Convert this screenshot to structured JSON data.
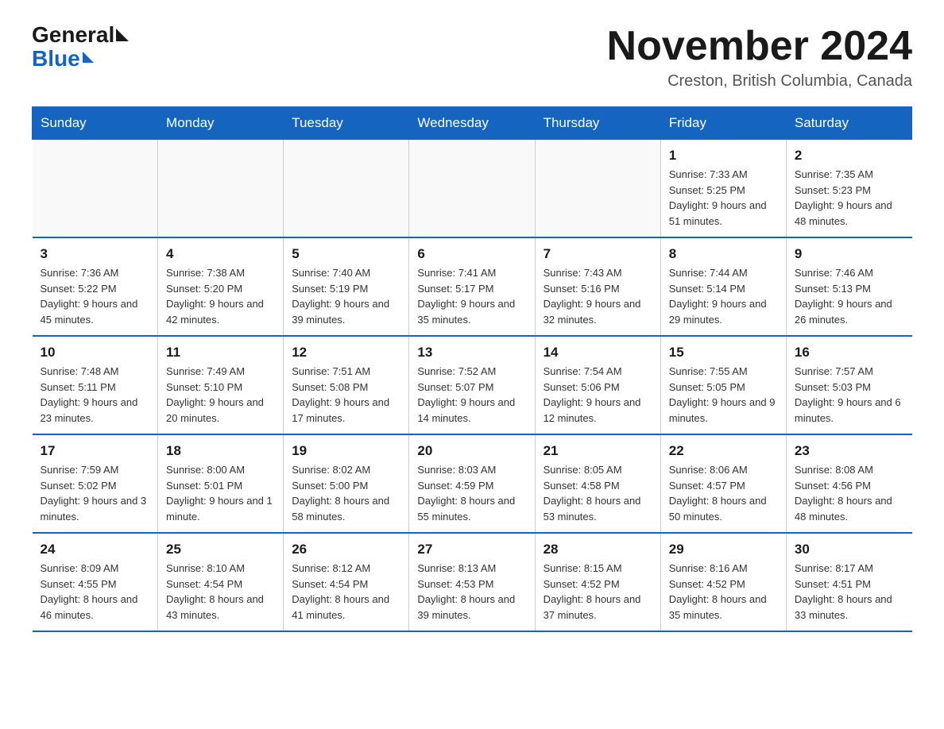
{
  "header": {
    "logo_general": "General",
    "logo_blue": "Blue",
    "month_title": "November 2024",
    "location": "Creston, British Columbia, Canada"
  },
  "days_of_week": [
    "Sunday",
    "Monday",
    "Tuesday",
    "Wednesday",
    "Thursday",
    "Friday",
    "Saturday"
  ],
  "weeks": [
    [
      {
        "day": "",
        "info": ""
      },
      {
        "day": "",
        "info": ""
      },
      {
        "day": "",
        "info": ""
      },
      {
        "day": "",
        "info": ""
      },
      {
        "day": "",
        "info": ""
      },
      {
        "day": "1",
        "info": "Sunrise: 7:33 AM\nSunset: 5:25 PM\nDaylight: 9 hours and 51 minutes."
      },
      {
        "day": "2",
        "info": "Sunrise: 7:35 AM\nSunset: 5:23 PM\nDaylight: 9 hours and 48 minutes."
      }
    ],
    [
      {
        "day": "3",
        "info": "Sunrise: 7:36 AM\nSunset: 5:22 PM\nDaylight: 9 hours and 45 minutes."
      },
      {
        "day": "4",
        "info": "Sunrise: 7:38 AM\nSunset: 5:20 PM\nDaylight: 9 hours and 42 minutes."
      },
      {
        "day": "5",
        "info": "Sunrise: 7:40 AM\nSunset: 5:19 PM\nDaylight: 9 hours and 39 minutes."
      },
      {
        "day": "6",
        "info": "Sunrise: 7:41 AM\nSunset: 5:17 PM\nDaylight: 9 hours and 35 minutes."
      },
      {
        "day": "7",
        "info": "Sunrise: 7:43 AM\nSunset: 5:16 PM\nDaylight: 9 hours and 32 minutes."
      },
      {
        "day": "8",
        "info": "Sunrise: 7:44 AM\nSunset: 5:14 PM\nDaylight: 9 hours and 29 minutes."
      },
      {
        "day": "9",
        "info": "Sunrise: 7:46 AM\nSunset: 5:13 PM\nDaylight: 9 hours and 26 minutes."
      }
    ],
    [
      {
        "day": "10",
        "info": "Sunrise: 7:48 AM\nSunset: 5:11 PM\nDaylight: 9 hours and 23 minutes."
      },
      {
        "day": "11",
        "info": "Sunrise: 7:49 AM\nSunset: 5:10 PM\nDaylight: 9 hours and 20 minutes."
      },
      {
        "day": "12",
        "info": "Sunrise: 7:51 AM\nSunset: 5:08 PM\nDaylight: 9 hours and 17 minutes."
      },
      {
        "day": "13",
        "info": "Sunrise: 7:52 AM\nSunset: 5:07 PM\nDaylight: 9 hours and 14 minutes."
      },
      {
        "day": "14",
        "info": "Sunrise: 7:54 AM\nSunset: 5:06 PM\nDaylight: 9 hours and 12 minutes."
      },
      {
        "day": "15",
        "info": "Sunrise: 7:55 AM\nSunset: 5:05 PM\nDaylight: 9 hours and 9 minutes."
      },
      {
        "day": "16",
        "info": "Sunrise: 7:57 AM\nSunset: 5:03 PM\nDaylight: 9 hours and 6 minutes."
      }
    ],
    [
      {
        "day": "17",
        "info": "Sunrise: 7:59 AM\nSunset: 5:02 PM\nDaylight: 9 hours and 3 minutes."
      },
      {
        "day": "18",
        "info": "Sunrise: 8:00 AM\nSunset: 5:01 PM\nDaylight: 9 hours and 1 minute."
      },
      {
        "day": "19",
        "info": "Sunrise: 8:02 AM\nSunset: 5:00 PM\nDaylight: 8 hours and 58 minutes."
      },
      {
        "day": "20",
        "info": "Sunrise: 8:03 AM\nSunset: 4:59 PM\nDaylight: 8 hours and 55 minutes."
      },
      {
        "day": "21",
        "info": "Sunrise: 8:05 AM\nSunset: 4:58 PM\nDaylight: 8 hours and 53 minutes."
      },
      {
        "day": "22",
        "info": "Sunrise: 8:06 AM\nSunset: 4:57 PM\nDaylight: 8 hours and 50 minutes."
      },
      {
        "day": "23",
        "info": "Sunrise: 8:08 AM\nSunset: 4:56 PM\nDaylight: 8 hours and 48 minutes."
      }
    ],
    [
      {
        "day": "24",
        "info": "Sunrise: 8:09 AM\nSunset: 4:55 PM\nDaylight: 8 hours and 46 minutes."
      },
      {
        "day": "25",
        "info": "Sunrise: 8:10 AM\nSunset: 4:54 PM\nDaylight: 8 hours and 43 minutes."
      },
      {
        "day": "26",
        "info": "Sunrise: 8:12 AM\nSunset: 4:54 PM\nDaylight: 8 hours and 41 minutes."
      },
      {
        "day": "27",
        "info": "Sunrise: 8:13 AM\nSunset: 4:53 PM\nDaylight: 8 hours and 39 minutes."
      },
      {
        "day": "28",
        "info": "Sunrise: 8:15 AM\nSunset: 4:52 PM\nDaylight: 8 hours and 37 minutes."
      },
      {
        "day": "29",
        "info": "Sunrise: 8:16 AM\nSunset: 4:52 PM\nDaylight: 8 hours and 35 minutes."
      },
      {
        "day": "30",
        "info": "Sunrise: 8:17 AM\nSunset: 4:51 PM\nDaylight: 8 hours and 33 minutes."
      }
    ]
  ]
}
